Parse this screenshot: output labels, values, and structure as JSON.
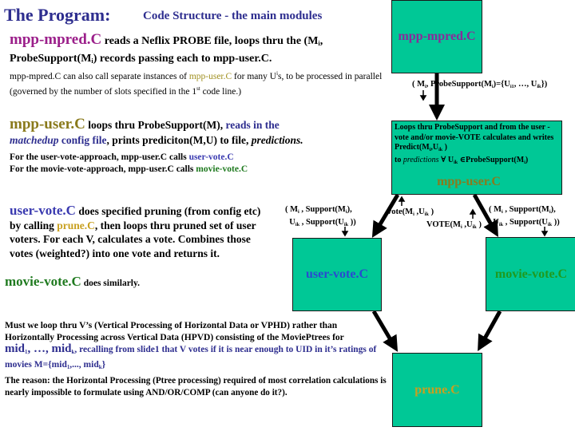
{
  "header": {
    "title": "The Program:",
    "subtitle": "Code Structure - the main modules"
  },
  "section_mpred": {
    "module": "mpp-mpred.C",
    "text1": " reads a Neflix PROBE file, loops thru the (M",
    "sub_i": "i",
    "text2": ",",
    "text3": "ProbeSupport(M",
    "text4": ") records passing each to mpp-user.C.",
    "note1": "mpp-mpred.C can also call separate instances of ",
    "note_link": "mpp-user.C",
    "note2": " for many U",
    "note_sup": "i",
    "note3": "s, to be processed in parallel (governed  by the number of slots specified in the 1",
    "note_st": "st",
    "note4": " code line.)"
  },
  "section_user": {
    "module": "mpp-user.C",
    "text1": "  loops thru ProbeSupport(M), ",
    "text_blue1": "reads in the",
    "text_blue_italic": "matchedup",
    "text_blue2": " config file",
    "text2": ", prints prediciton(M,U) to file, ",
    "text_italic": "predictions.",
    "line1_prefix": "For the user-vote-approach, mpp-user.C    calls ",
    "line1_link": "user-vote.C",
    "line2_prefix": "For the movie-vote-approach, mpp-user.C calls ",
    "line2_link": "movie-vote.C"
  },
  "section_uservote": {
    "module": "user-vote.C",
    "text1": " does specified pruning (from config etc)  by calling ",
    "link": "prune.C",
    "text2": ", then loops thru pruned set of user voters.  For each V, calculates a vote.  Combines those votes (weighted?) into one vote and returns it."
  },
  "section_movievote": {
    "module": "movie-vote.C",
    "text": " does similarly."
  },
  "section_question": {
    "text1": "Must we loop  thru V’s (Vertical Processing of Horizontal Data or VPHD) rather than Horizontally Processing across Vertical Data (HPVD) consisting of the  MoviePtrees for",
    "mid": "mid",
    "sub1": "1",
    "ellipsis": ", …, ",
    "subk": "k",
    "text2": ", recalling from slide1 that V votes if it is near enough to UID in it’s ratings of movies M={mid",
    "text3": ",..., mid",
    "text4": "}"
  },
  "section_reason": {
    "text": "The reason: the Horizontal Processing (Ptree processing) required of most correlation calculations is nearly impossible to formulate using AND/OR/COMP (can anyone do it?)."
  },
  "diagram": {
    "box_mpred": "mpp-mpred.C",
    "box_user_desc1": "Loops thru ProbeSupport and from the user -vote and/or movie-VOTE calculates and writes Predict(M",
    "box_user_desc_sub1": "i",
    "box_user_desc_comma": ",U",
    "box_user_desc_sub2": "ik",
    "box_user_desc2": " )",
    "box_user_desc3": "to ",
    "box_user_desc_italic": "predictions",
    "box_user_desc4": " ∀ U",
    "box_user_desc5": " ∈ProbeSupport(M",
    "box_user_desc6": ")",
    "box_user_name": "mpp-user.C",
    "box_uservote": "user-vote.C",
    "box_movievote": "movie-vote.C",
    "box_prune": "prune.C",
    "lbl_probe": "( M",
    "lbl_probe2": ", ProbeSupport(M",
    "lbl_probe3": ")={U",
    "lbl_probe4": ", …, U",
    "lbl_probe5": "})",
    "lbl_args1": "( M",
    "lbl_args2": " ,  Support(M",
    "lbl_args3": "),",
    "lbl_args4": "U",
    "lbl_args5": " , Support(U",
    "lbl_args6": " ))",
    "lbl_vote": "vote(M",
    "lbl_VOTE": "VOTE(M",
    "lbl_tail": " ,U",
    "lbl_close": " )",
    "sub_i": "i",
    "sub_ik": "ik",
    "sub_i1": "i1",
    "colors": {
      "box_fill": "#00c896",
      "mpred_text": "#8a2a9a",
      "user_text": "#8a7a1c",
      "uservote_text": "#2a4ad0",
      "movievote_text": "#1f9a1f",
      "prune_text": "#c8a020"
    }
  }
}
